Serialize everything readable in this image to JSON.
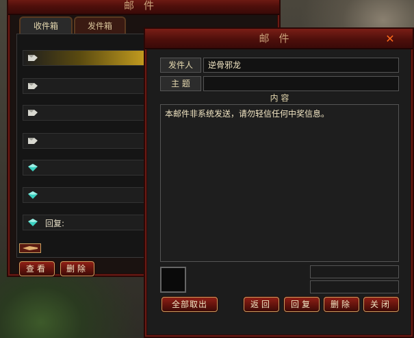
{
  "inbox_window": {
    "title": "邮件",
    "tabs": [
      {
        "label": "收件箱",
        "active": true
      },
      {
        "label": "发件箱",
        "active": false
      }
    ],
    "mail_items": [
      {
        "icon": "read-mail-icon",
        "label": "",
        "selected": true
      },
      {
        "icon": "read-mail-icon",
        "label": "",
        "selected": false
      },
      {
        "icon": "read-mail-icon",
        "label": "",
        "selected": false
      },
      {
        "icon": "read-mail-icon",
        "label": "",
        "selected": false
      },
      {
        "icon": "unread-gem-icon",
        "label": "",
        "selected": false
      },
      {
        "icon": "unread-gem-icon",
        "label": "",
        "selected": false
      },
      {
        "icon": "unread-gem-icon",
        "label": "回复:",
        "selected": false
      }
    ],
    "view_button": "查看",
    "delete_button": "删除"
  },
  "mail_window": {
    "title": "邮件",
    "sender_label": "发件人",
    "sender_value": "逆骨邪龙",
    "subject_label": "主 题",
    "subject_value": "",
    "content_label": "内 容",
    "content_text": "本邮件非系统发送，请勿轻信任何中奖信息。",
    "buttons": {
      "take_all": "全部取出",
      "back": "返回",
      "reply": "回复",
      "delete": "删除",
      "close": "关闭"
    }
  },
  "colors": {
    "frame_red": "#6b1a14",
    "title_text": "#c9a27a",
    "content_text": "#f2e6c4",
    "selected_row": "#c8a020",
    "gem_teal": "#3ad0c0",
    "close_x": "#ff6a1a"
  }
}
